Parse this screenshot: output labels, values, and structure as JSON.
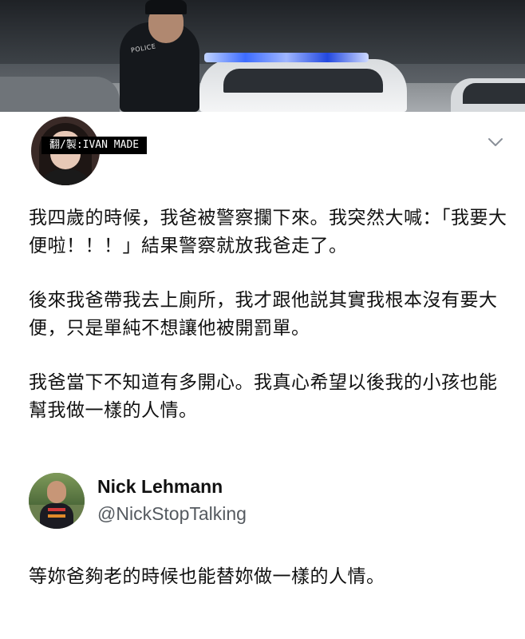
{
  "banner": {
    "badge_text": "POLICE"
  },
  "watermark": {
    "text": "翻/製:IVAN MADE"
  },
  "post": {
    "menu_icon": "chevron-down-icon",
    "paragraphs": [
      "我四歲的時候，我爸被警察攔下來。我突然大喊：「我要大便啦！！！」結果警察就放我爸走了。",
      "後來我爸帶我去上廁所，我才跟他説其實我根本沒有要大便，只是單純不想讓他被開罰單。",
      "我爸當下不知道有多開心。我真心希望以後我的小孩也能幫我做一樣的人情。"
    ]
  },
  "reply": {
    "display_name": "Nick Lehmann",
    "handle": "@NickStopTalking",
    "text": "等妳爸夠老的時候也能替妳做一樣的人情。"
  },
  "colors": {
    "background": "#ffffff",
    "text": "#111111",
    "handle": "#555a60",
    "police_light_blue": "#3d6cff"
  }
}
